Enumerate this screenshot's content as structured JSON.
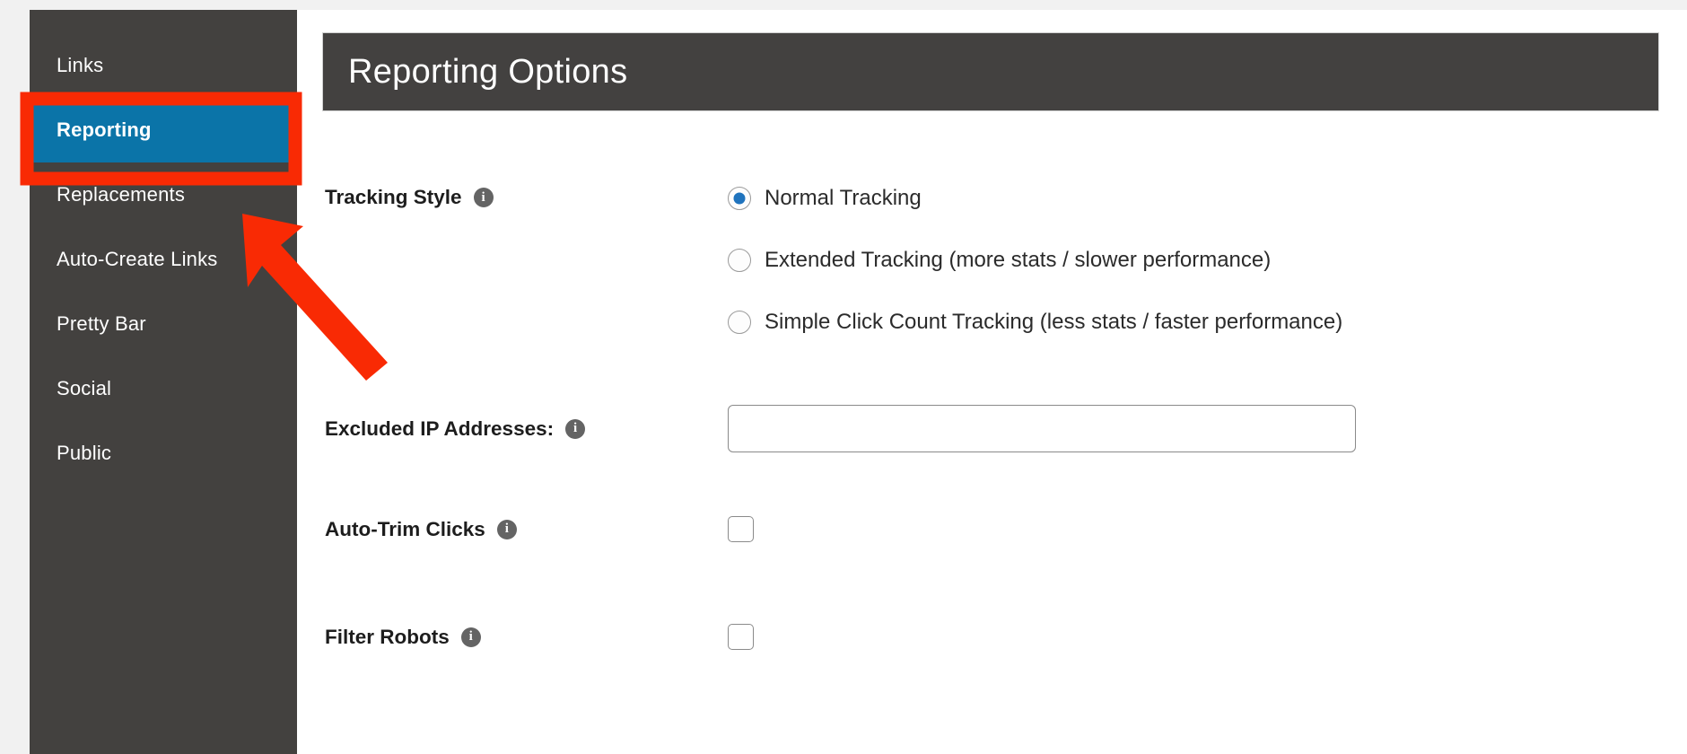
{
  "sidebar": {
    "items": [
      {
        "label": "Links",
        "active": false
      },
      {
        "label": "Reporting",
        "active": true
      },
      {
        "label": "Replacements",
        "active": false
      },
      {
        "label": "Auto-Create Links",
        "active": false
      },
      {
        "label": "Pretty Bar",
        "active": false
      },
      {
        "label": "Social",
        "active": false
      },
      {
        "label": "Public",
        "active": false
      }
    ]
  },
  "header": {
    "title": "Reporting Options"
  },
  "form": {
    "tracking_style": {
      "label": "Tracking Style",
      "info_icon": "info-icon",
      "options": [
        {
          "label": "Normal Tracking",
          "selected": true
        },
        {
          "label": "Extended Tracking (more stats / slower performance)",
          "selected": false
        },
        {
          "label": "Simple Click Count Tracking (less stats / faster performance)",
          "selected": false
        }
      ]
    },
    "excluded_ips": {
      "label": "Excluded IP Addresses:",
      "info_icon": "info-icon",
      "value": "",
      "placeholder": ""
    },
    "auto_trim_clicks": {
      "label": "Auto-Trim Clicks",
      "info_icon": "info-icon",
      "checked": false
    },
    "filter_robots": {
      "label": "Filter Robots",
      "info_icon": "info-icon",
      "checked": false
    }
  },
  "annotation": {
    "highlight_target": "Reporting",
    "arrow": "red-arrow-pointer",
    "colors": {
      "accent_blue": "#0b74a8",
      "sidebar_dark": "#43413f",
      "header_dark": "#434140",
      "annotation_red": "#f92a04",
      "radio_blue": "#1f73bd"
    }
  }
}
